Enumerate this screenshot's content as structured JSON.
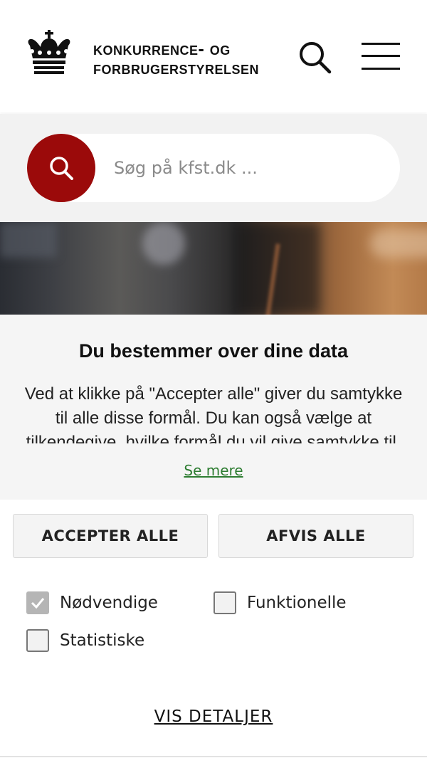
{
  "header": {
    "logo_line1": "Konkurrence- og",
    "logo_line2": "Forbrugerstyrelsen",
    "icons": {
      "logo": "crown-logo-icon",
      "search": "search-icon",
      "menu": "menu-icon"
    }
  },
  "search": {
    "placeholder": "Søg på kfst.dk ...",
    "button_icon": "search-icon",
    "button_color": "#9b0a0a"
  },
  "hero": {
    "description_icon": "hero-photo"
  },
  "consent": {
    "title": "Du bestemmer over dine data",
    "text": "Ved at klikke på \"Accepter alle\" giver du samtykke til alle disse formål. Du kan også vælge at tilkendegive, hvilke formål du vil give samtykke til.",
    "see_more": "Se mere",
    "accept_all": "ACCEPTER ALLE",
    "reject_all": "AFVIS ALLE",
    "link_color": "#2e7d32",
    "options": [
      {
        "label": "Nødvendige",
        "checked": true,
        "disabled": true
      },
      {
        "label": "Funktionelle",
        "checked": false
      },
      {
        "label": "Statistiske",
        "checked": false
      }
    ],
    "show_details": "VIS DETALJER"
  }
}
